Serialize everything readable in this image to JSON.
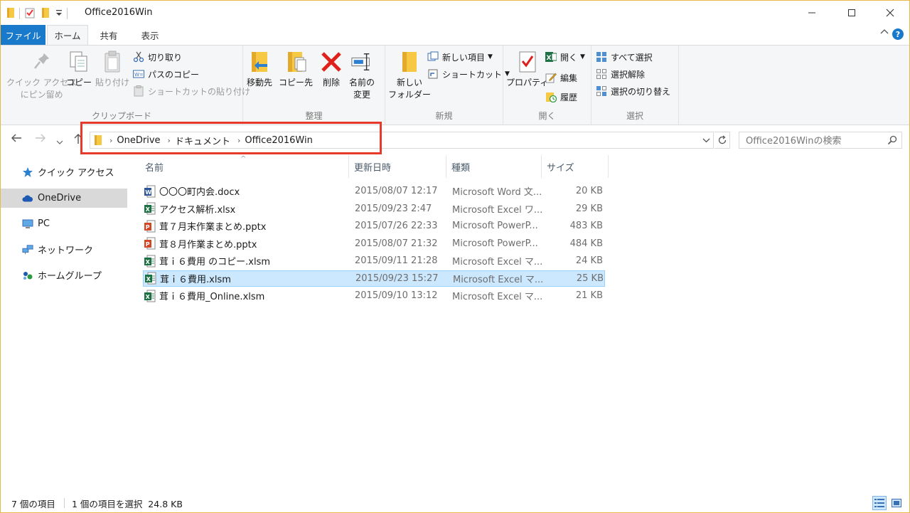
{
  "window": {
    "title": "Office2016Win"
  },
  "ribbon": {
    "tabs": [
      {
        "label": "ファイル"
      },
      {
        "label": "ホーム"
      },
      {
        "label": "共有"
      },
      {
        "label": "表示"
      }
    ],
    "help": "?",
    "groups": {
      "clipboard": {
        "label": "クリップボード",
        "pin_line1": "クイック アクセス",
        "pin_line2": "にピン留め",
        "copy": "コピー",
        "paste": "貼り付け",
        "cut": "切り取り",
        "copy_path": "パスのコピー",
        "paste_shortcut": "ショートカットの貼り付け"
      },
      "organize": {
        "label": "整理",
        "move_to": "移動先",
        "copy_to": "コピー先",
        "delete": "削除",
        "rename_line1": "名前の",
        "rename_line2": "変更"
      },
      "new": {
        "label": "新規",
        "new_folder_line1": "新しい",
        "new_folder_line2": "フォルダー",
        "new_item": "新しい項目",
        "shortcut": "ショートカット"
      },
      "open": {
        "label": "開く",
        "properties": "プロパティ",
        "open": "開く",
        "edit": "編集",
        "history": "履歴"
      },
      "select": {
        "label": "選択",
        "select_all": "すべて選択",
        "select_none": "選択解除",
        "invert": "選択の切り替え"
      }
    }
  },
  "address": {
    "crumbs": [
      "OneDrive",
      "ドキュメント",
      "Office2016Win"
    ],
    "search_placeholder": "Office2016Winの検索"
  },
  "nav_pane": {
    "items": [
      {
        "label": "クイック アクセス",
        "icon": "star-icon"
      },
      {
        "label": "OneDrive",
        "icon": "cloud-icon"
      },
      {
        "label": "PC",
        "icon": "computer-icon"
      },
      {
        "label": "ネットワーク",
        "icon": "network-icon"
      },
      {
        "label": "ホームグループ",
        "icon": "homegroup-icon"
      }
    ]
  },
  "file_list": {
    "columns": [
      "名前",
      "更新日時",
      "種類",
      "サイズ"
    ],
    "sort_indicator": "^",
    "rows": [
      {
        "name": "〇〇〇町内会.docx",
        "date": "2015/08/07 12:17",
        "type": "Microsoft Word 文...",
        "size": "20 KB",
        "app": "word"
      },
      {
        "name": "アクセス解析.xlsx",
        "date": "2015/09/23 2:47",
        "type": "Microsoft Excel ワ...",
        "size": "29 KB",
        "app": "excel"
      },
      {
        "name": "茸７月末作業まとめ.pptx",
        "date": "2015/07/26 22:33",
        "type": "Microsoft PowerP...",
        "size": "483 KB",
        "app": "ppt"
      },
      {
        "name": "茸８月作業まとめ.pptx",
        "date": "2015/08/07 21:32",
        "type": "Microsoft PowerP...",
        "size": "484 KB",
        "app": "ppt"
      },
      {
        "name": "茸ｉ６費用 のコピー.xlsm",
        "date": "2015/09/11 21:28",
        "type": "Microsoft Excel マ...",
        "size": "24 KB",
        "app": "excel"
      },
      {
        "name": "茸ｉ６費用.xlsm",
        "date": "2015/09/23 15:27",
        "type": "Microsoft Excel マ...",
        "size": "25 KB",
        "app": "excel",
        "selected": true
      },
      {
        "name": "茸ｉ６費用_Online.xlsm",
        "date": "2015/09/10 13:12",
        "type": "Microsoft Excel マ...",
        "size": "21 KB",
        "app": "excel"
      }
    ]
  },
  "status": {
    "item_count": "7 個の項目",
    "selection": "1 個の項目を選択  24.8 KB"
  },
  "colors": {
    "accent": "#1979ca",
    "selection": "#cce8ff",
    "highlight": "#e83a2a"
  }
}
